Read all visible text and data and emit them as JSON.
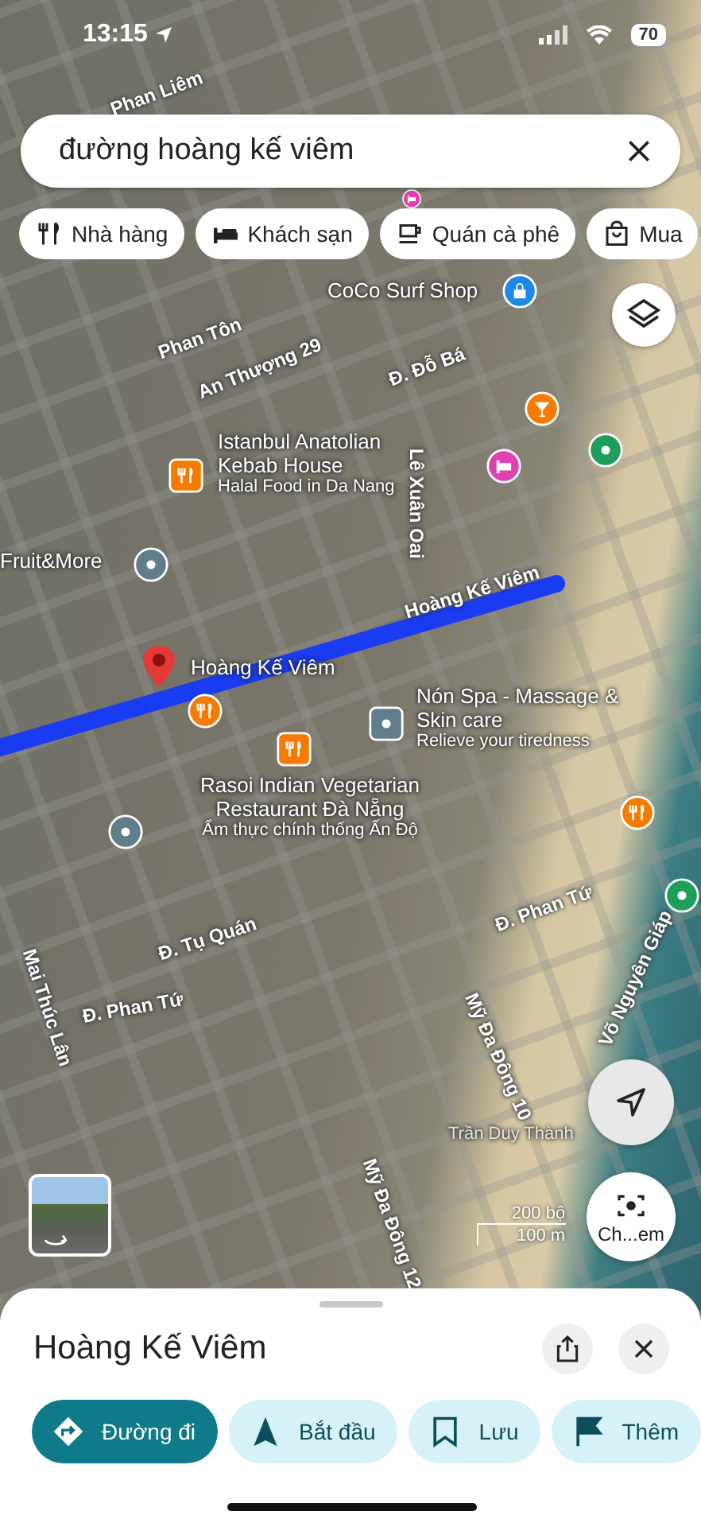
{
  "status_bar": {
    "time": "13:15",
    "battery": "70"
  },
  "search": {
    "value": "đường hoàng kế viêm"
  },
  "chips": [
    {
      "label": "Nhà hàng",
      "kind": "restaurant"
    },
    {
      "label": "Khách sạn",
      "kind": "hotel"
    },
    {
      "label": "Quán cà phê",
      "kind": "cafe"
    },
    {
      "label": "Mua",
      "kind": "shopping"
    }
  ],
  "map": {
    "streets": [
      {
        "label": "Phan Liêm"
      },
      {
        "label": "Phan Tôn"
      },
      {
        "label": "An Thượng 29"
      },
      {
        "label": "Đ. Đỗ Bá"
      },
      {
        "label": "Lê Xuân Oai"
      },
      {
        "label": "Hoàng Kế Viêm"
      },
      {
        "label": "Mai Thúc Lân"
      },
      {
        "label": "Đ. Tụ Quán"
      },
      {
        "label": "Đ. Phan Tứ"
      },
      {
        "label": "Đ. Phan Tứ"
      },
      {
        "label": "Mỹ Đa Đông 10"
      },
      {
        "label": "Mỹ Đa Đông 12"
      },
      {
        "label": "Võ Nguyên Giáp"
      }
    ],
    "places": [
      {
        "name": "CoCo Surf Shop"
      },
      {
        "name": "Istanbul Anatolian Kebab House",
        "subtitle": "Halal Food in Da Nang"
      },
      {
        "name": "Fruit&More"
      },
      {
        "name": "Hoàng Kế Viêm"
      },
      {
        "name": "Nón Spa - Massage & Skin care",
        "subtitle": "Relieve your tiredness"
      },
      {
        "name": "Rasoi Indian Vegetarian Restaurant Đà Nẵng",
        "subtitle": "Ẩm thực chính thống Ấn Độ"
      },
      {
        "name": "Trần Duy Thành"
      }
    ],
    "pins": [
      {
        "kind": "shop",
        "color": "#1e88e5"
      },
      {
        "kind": "bar",
        "color": "#f57c00"
      },
      {
        "kind": "dot",
        "color": "#1e9e5a"
      },
      {
        "kind": "hotel",
        "color": "#e040b0"
      },
      {
        "kind": "food-square",
        "color": "#f57c00"
      },
      {
        "kind": "dot",
        "color": "#607d8b"
      },
      {
        "kind": "marker",
        "color": "#e53935"
      },
      {
        "kind": "food",
        "color": "#f57c00"
      },
      {
        "kind": "food-square",
        "color": "#f57c00"
      },
      {
        "kind": "dot-square",
        "color": "#607d8b"
      },
      {
        "kind": "food",
        "color": "#f57c00"
      },
      {
        "kind": "dot",
        "color": "#607d8b"
      },
      {
        "kind": "hotel",
        "color": "#e040b0"
      },
      {
        "kind": "dot",
        "color": "#1e9e5a"
      }
    ],
    "scale": {
      "imperial": "200 bộ",
      "metric": "100 m"
    }
  },
  "camera_button": {
    "label": "Ch...em"
  },
  "sheet": {
    "title": "Hoàng Kế Viêm",
    "actions": [
      {
        "label": "Đường đi",
        "kind": "directions",
        "primary": true
      },
      {
        "label": "Bắt đầu",
        "kind": "start",
        "primary": false
      },
      {
        "label": "Lưu",
        "kind": "save",
        "primary": false
      },
      {
        "label": "Thêm",
        "kind": "more",
        "primary": false
      }
    ]
  }
}
